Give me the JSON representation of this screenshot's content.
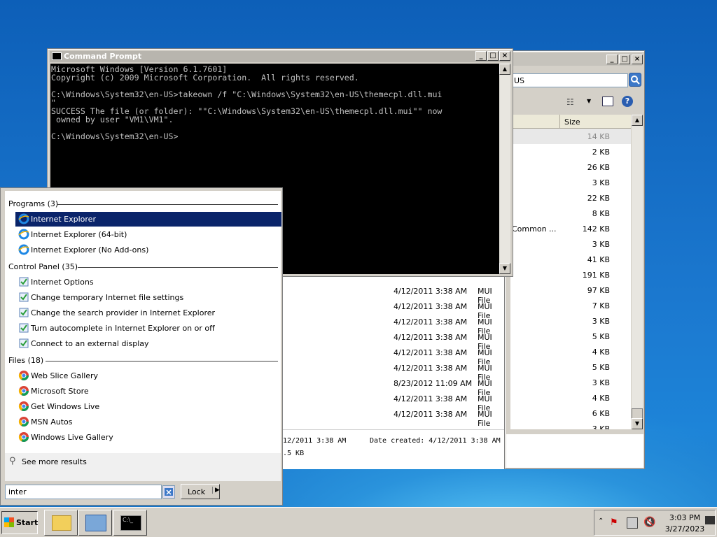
{
  "cmd": {
    "title": "Command Prompt",
    "lines": [
      "Microsoft Windows [Version 6.1.7601]",
      "Copyright (c) 2009 Microsoft Corporation.  All rights reserved.",
      "",
      "C:\\Windows\\System32\\en-US>takeown /f \"C:\\Windows\\System32\\en-US\\themecpl.dll.mui",
      "\"",
      "SUCCESS The file (or folder): \"\"C:\\Windows\\System32\\en-US\\themecpl.dll.mui\"\" now",
      " owned by user \"VM1\\VM1\".",
      "",
      "C:\\Windows\\System32\\en-US>"
    ]
  },
  "explorer": {
    "address": "US",
    "size_header": "Size",
    "partial_label": "Common ...",
    "right_sizes": [
      "14 KB",
      "2 KB",
      "26 KB",
      "3 KB",
      "22 KB",
      "8 KB",
      "142 KB",
      "3 KB",
      "41 KB",
      "191 KB",
      "97 KB",
      "7 KB",
      "3 KB",
      "5 KB",
      "4 KB",
      "5 KB",
      "3 KB",
      "4 KB",
      "6 KB",
      "3 KB"
    ],
    "rows": [
      {
        "date": "4/12/2011 3:38 AM",
        "type": "MUI File",
        "size": "97 KB"
      },
      {
        "date": "4/12/2011 3:38 AM",
        "type": "MUI File",
        "size": "7 KB"
      },
      {
        "date": "4/12/2011 3:38 AM",
        "type": "MUI File",
        "size": "3 KB"
      },
      {
        "date": "4/12/2011 3:38 AM",
        "type": "MUI File",
        "size": "5 KB"
      },
      {
        "date": "4/12/2011 3:38 AM",
        "type": "MUI File",
        "size": "4 KB"
      },
      {
        "date": "4/12/2011 3:38 AM",
        "type": "MUI File",
        "size": "5 KB"
      },
      {
        "date": "8/23/2012 11:09 AM",
        "type": "MUI File",
        "size": "3 KB"
      },
      {
        "date": "4/12/2011 3:38 AM",
        "type": "MUI File",
        "size": "4 KB"
      },
      {
        "date": "4/12/2011 3:38 AM",
        "type": "MUI File",
        "size": "6 KB"
      }
    ],
    "detail_modified": "12/2011 3:38 AM",
    "detail_created": "Date created: 4/12/2011 3:38 AM",
    "detail_size": ".5 KB"
  },
  "startmenu": {
    "programs_header": "Programs (3)",
    "programs": [
      "Internet Explorer",
      "Internet Explorer (64-bit)",
      "Internet Explorer (No Add-ons)"
    ],
    "cp_header": "Control Panel (35)",
    "control_panel": [
      "Internet Options",
      "Change temporary Internet file settings",
      "Change the search provider in Internet Explorer",
      "Turn autocomplete in Internet Explorer on or off",
      "Connect to an external display"
    ],
    "files_header": "Files (18)",
    "files": [
      "Web Slice Gallery",
      "Microsoft Store",
      "Get Windows Live",
      "MSN Autos",
      "Windows Live Gallery"
    ],
    "see_more": "See more results",
    "search_value": "inter",
    "lock_label": "Lock"
  },
  "taskbar": {
    "start_label": "Start",
    "time": "3:03 PM",
    "date": "3/27/2023"
  }
}
